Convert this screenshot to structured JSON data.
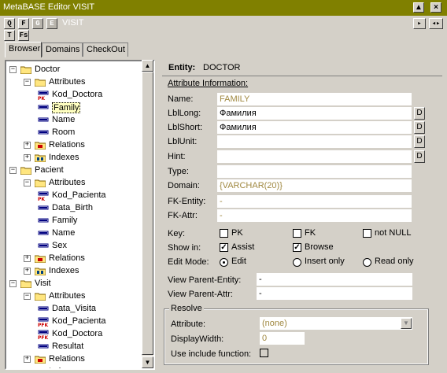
{
  "window": {
    "title": "MetaBASE Editor VISIT",
    "close_glyph": "×",
    "max_glyph": "▲",
    "arrows_glyph": "◂▸"
  },
  "toolbar": {
    "buttons_row1": [
      "Q",
      "F",
      "G",
      "E"
    ],
    "visit_label": "VISIT",
    "buttons_row2": [
      "T",
      "Fs"
    ]
  },
  "tabs": [
    "Browser",
    "Domains",
    "CheckOut"
  ],
  "tree": {
    "expander_plus": "+",
    "expander_minus": "−",
    "rows": [
      {
        "label": "Doctor",
        "level": 0,
        "type": "folder",
        "expander": "minus"
      },
      {
        "label": "Attributes",
        "level": 1,
        "type": "folder",
        "expander": "minus"
      },
      {
        "label": "Kod_Doctora",
        "level": 2,
        "type": "pk"
      },
      {
        "label": "Family",
        "level": 2,
        "type": "attr",
        "selected": true
      },
      {
        "label": "Name",
        "level": 2,
        "type": "attr"
      },
      {
        "label": "Room",
        "level": 2,
        "type": "attr"
      },
      {
        "label": "Relations",
        "level": 1,
        "type": "relfolder",
        "expander": "plus"
      },
      {
        "label": "Indexes",
        "level": 1,
        "type": "idxfolder",
        "expander": "plus"
      },
      {
        "label": "Pacient",
        "level": 0,
        "type": "folder",
        "expander": "minus"
      },
      {
        "label": "Attributes",
        "level": 1,
        "type": "folder",
        "expander": "minus"
      },
      {
        "label": "Kod_Pacienta",
        "level": 2,
        "type": "pk"
      },
      {
        "label": "Data_Birth",
        "level": 2,
        "type": "attr"
      },
      {
        "label": "Family",
        "level": 2,
        "type": "attr"
      },
      {
        "label": "Name",
        "level": 2,
        "type": "attr"
      },
      {
        "label": "Sex",
        "level": 2,
        "type": "attr"
      },
      {
        "label": "Relations",
        "level": 1,
        "type": "relfolder",
        "expander": "plus"
      },
      {
        "label": "Indexes",
        "level": 1,
        "type": "idxfolder",
        "expander": "plus"
      },
      {
        "label": "Visit",
        "level": 0,
        "type": "folder",
        "expander": "minus"
      },
      {
        "label": "Attributes",
        "level": 1,
        "type": "folder",
        "expander": "minus"
      },
      {
        "label": "Data_Visita",
        "level": 2,
        "type": "attr"
      },
      {
        "label": "Kod_Pacienta",
        "level": 2,
        "type": "pfk"
      },
      {
        "label": "Kod_Doctora",
        "level": 2,
        "type": "pfk"
      },
      {
        "label": "Resultat",
        "level": 2,
        "type": "attr"
      },
      {
        "label": "Relations",
        "level": 1,
        "type": "relfolder",
        "expander": "plus"
      },
      {
        "label": "Indexes",
        "level": 1,
        "type": "idxfolder",
        "expander": "plus"
      }
    ]
  },
  "entity": {
    "label": "Entity:",
    "name": "DOCTOR"
  },
  "attr_info": {
    "heading": "Attribute Information:",
    "d_button": "D",
    "fields": [
      {
        "label": "Name:",
        "value": "FAMILY",
        "style": "olive",
        "has_d": false
      },
      {
        "label": "LblLong:",
        "value": "Фамилия",
        "style": "plain",
        "has_d": true
      },
      {
        "label": "LblShort:",
        "value": "Фамилия",
        "style": "plain",
        "has_d": true
      },
      {
        "label": "LblUnit:",
        "value": "",
        "style": "plain",
        "has_d": true
      },
      {
        "label": "Hint:",
        "value": "",
        "style": "plain",
        "has_d": true
      },
      {
        "label": "Type:",
        "value": "",
        "style": "plain",
        "has_d": false
      },
      {
        "label": "Domain:",
        "value": "{VARCHAR(20)}",
        "style": "olive",
        "has_d": false
      },
      {
        "label": "FK-Entity:",
        "value": "-",
        "style": "olive",
        "has_d": false
      },
      {
        "label": "FK-Attr:",
        "value": "-",
        "style": "olive",
        "has_d": false
      }
    ],
    "key": {
      "label": "Key:",
      "options": [
        {
          "label": "PK",
          "checked": false
        },
        {
          "label": "FK",
          "checked": false
        },
        {
          "label": "not NULL",
          "checked": false
        }
      ]
    },
    "show_in": {
      "label": "Show in:",
      "options": [
        {
          "label": "Assist",
          "checked": true
        },
        {
          "label": "Browse",
          "checked": true
        }
      ]
    },
    "edit_mode": {
      "label": "Edit Mode:",
      "options": [
        {
          "label": "Edit",
          "selected": true
        },
        {
          "label": "Insert only",
          "selected": false
        },
        {
          "label": "Read only",
          "selected": false
        }
      ]
    },
    "view_parent_entity": {
      "label": "View Parent-Entity:",
      "value": "-"
    },
    "view_parent_attr": {
      "label": "View Parent-Attr:",
      "value": "-"
    }
  },
  "resolve": {
    "title": "Resolve",
    "attribute_label": "Attribute:",
    "attribute_value": "(none)",
    "display_width_label": "DisplayWidth:",
    "display_width_value": "0",
    "include_fn_label": "Use include function:",
    "include_fn_checked": false,
    "check_glyph": "✓"
  },
  "colors": {
    "titlebar": "#808000",
    "olive_text": "#a08840",
    "selection": "#ffffc0",
    "chrome": "#d4d0c8"
  }
}
